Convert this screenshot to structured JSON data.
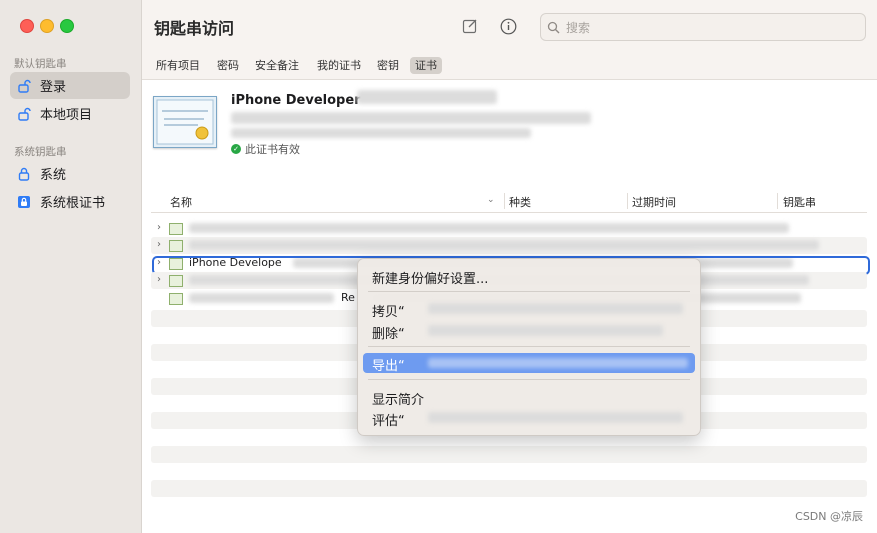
{
  "window": {
    "title": "钥匙串访问"
  },
  "sidebar": {
    "sections": [
      {
        "label": "默认钥匙串",
        "items": [
          {
            "label": "登录",
            "selected": true,
            "icon": "lock-open-icon"
          },
          {
            "label": "本地项目",
            "selected": false,
            "icon": "lock-open-icon"
          }
        ]
      },
      {
        "label": "系统钥匙串",
        "items": [
          {
            "label": "系统",
            "selected": false,
            "icon": "lock-icon"
          },
          {
            "label": "系统根证书",
            "selected": false,
            "icon": "lock-box-icon"
          }
        ]
      }
    ]
  },
  "toolbar": {
    "search_placeholder": "搜索",
    "compose_icon": "compose-icon",
    "info_icon": "info-icon"
  },
  "tabs": [
    {
      "label": "所有项目"
    },
    {
      "label": "密码"
    },
    {
      "label": "安全备注"
    },
    {
      "label": "我的证书"
    },
    {
      "label": "密钥"
    },
    {
      "label": "证书",
      "active": true
    }
  ],
  "certificate": {
    "name": "iPhone Developer",
    "valid_text": "此证书有效"
  },
  "table": {
    "columns": [
      "名称",
      "种类",
      "过期时间",
      "钥匙串"
    ],
    "rows": [
      {
        "name": ""
      },
      {
        "name": ""
      },
      {
        "name": "iPhone Develope",
        "selected": true
      },
      {
        "name": ""
      },
      {
        "name": "Re"
      }
    ]
  },
  "context_menu": {
    "items": [
      {
        "label": "新建身份偏好设置..."
      },
      {
        "label": "拷贝“"
      },
      {
        "label": "删除“"
      },
      {
        "label": "导出“",
        "highlighted": true
      },
      {
        "label": "显示简介"
      },
      {
        "label": "评估“"
      }
    ]
  },
  "watermark": "CSDN @凉辰"
}
